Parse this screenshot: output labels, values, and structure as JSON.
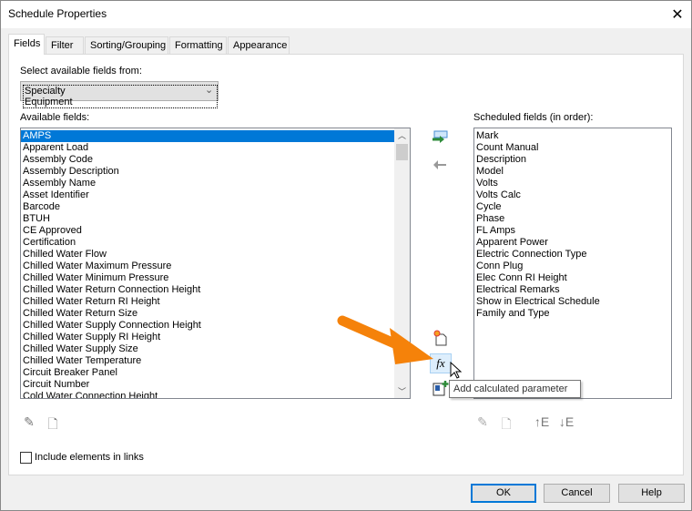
{
  "window": {
    "title": "Schedule Properties"
  },
  "tabs": [
    {
      "label": "Fields"
    },
    {
      "label": "Filter"
    },
    {
      "label": "Sorting/Grouping"
    },
    {
      "label": "Formatting"
    },
    {
      "label": "Appearance"
    }
  ],
  "select_label": "Select available fields from:",
  "select_value": "Specialty Equipment",
  "available_label": "Available fields:",
  "available_fields": [
    "AMPS",
    "Apparent Load",
    "Assembly Code",
    "Assembly Description",
    "Assembly Name",
    "Asset Identifier",
    "Barcode",
    "BTUH",
    "CE Approved",
    "Certification",
    "Chilled Water Flow",
    "Chilled Water Maximum Pressure",
    "Chilled Water Minimum Pressure",
    "Chilled Water Return Connection Height",
    "Chilled Water Return RI Height",
    "Chilled Water Return Size",
    "Chilled Water Supply Connection Height",
    "Chilled Water Supply RI Height",
    "Chilled Water Supply Size",
    "Chilled Water Temperature",
    "Circuit Breaker Panel",
    "Circuit Number",
    "Cold Water Connection Height"
  ],
  "selected_available": "AMPS",
  "scheduled_label": "Scheduled fields (in order):",
  "scheduled_fields": [
    "Mark",
    "Count Manual",
    "Description",
    "Model",
    "Volts",
    "Volts Calc",
    "Cycle",
    "Phase",
    "FL Amps",
    "Apparent Power",
    "Electric Connection Type",
    "Conn Plug",
    "Elec Conn RI Height",
    "Electrical Remarks",
    "Show in Electrical Schedule",
    "Family and Type"
  ],
  "tooltip": "Add calculated parameter",
  "include_links": "Include elements in links",
  "include_links_checked": false,
  "buttons": {
    "ok": "OK",
    "cancel": "Cancel",
    "help": "Help"
  },
  "icons": {
    "fx": "fx",
    "move_up": "↑E",
    "move_down": "↓E"
  },
  "colors": {
    "selection": "#0078d7",
    "arrow": "#f5820a",
    "add_arrow": "#2e8b3a"
  }
}
